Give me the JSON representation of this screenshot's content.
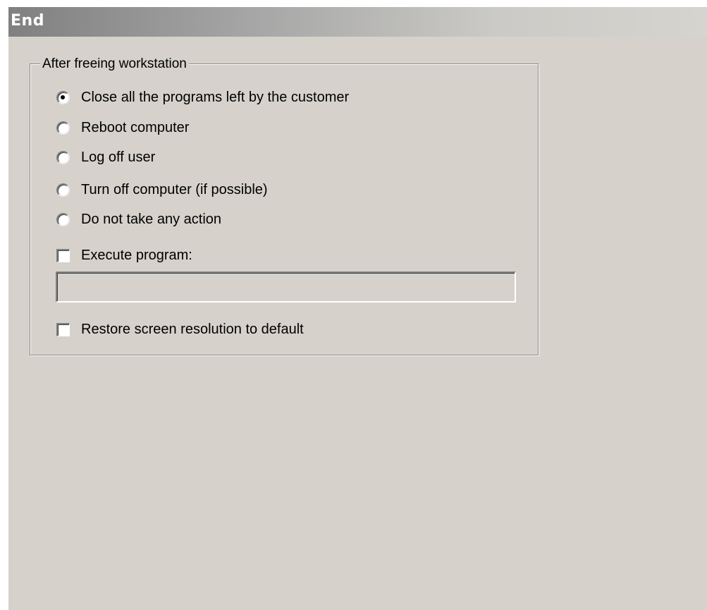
{
  "title": "End",
  "group": {
    "legend": "After freeing workstation",
    "actions": [
      {
        "label": "Close all the programs left by the customer",
        "selected": true
      },
      {
        "label": "Reboot computer",
        "selected": false
      },
      {
        "label": "Log off user",
        "selected": false
      },
      {
        "label": "Turn off computer (if possible)",
        "selected": false
      },
      {
        "label": "Do not take any action",
        "selected": false
      }
    ],
    "execute_program": {
      "label": "Execute program:",
      "checked": false,
      "value": "",
      "placeholder": ""
    },
    "restore_resolution": {
      "label": "Restore screen resolution to default",
      "checked": false
    }
  }
}
